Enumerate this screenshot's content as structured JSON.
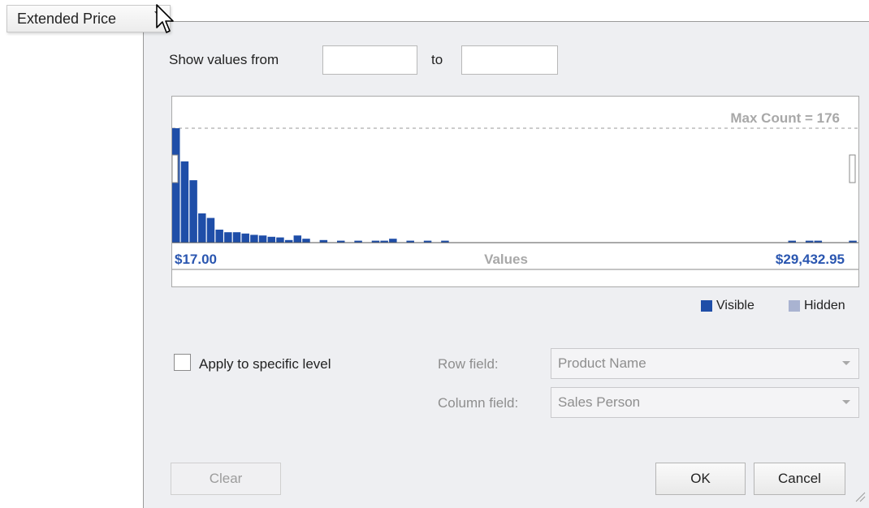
{
  "field_header": {
    "label": "Extended Price"
  },
  "range": {
    "from_label": "Show values from",
    "to_label": "to",
    "from_value": "",
    "to_value": ""
  },
  "chart_data": {
    "type": "bar",
    "annotation": "Max Count = 176",
    "max_count": 176,
    "x_min_label": "$17.00",
    "x_axis_label": "Values",
    "x_max_label": "$29,432.95",
    "values": [
      176,
      125,
      96,
      45,
      38,
      20,
      16,
      16,
      14,
      12,
      11,
      9,
      8,
      4,
      11,
      6,
      0,
      4,
      0,
      3,
      0,
      3,
      0,
      3,
      3,
      6,
      0,
      3,
      0,
      3,
      0,
      3,
      0,
      0,
      0,
      0,
      0,
      0,
      0,
      0,
      0,
      0,
      0,
      0,
      0,
      0,
      0,
      0,
      0,
      0,
      0,
      0,
      0,
      0,
      0,
      0,
      0,
      0,
      0,
      0,
      0,
      0,
      0,
      0,
      0,
      0,
      0,
      0,
      0,
      0,
      0,
      3,
      0,
      3,
      3,
      0,
      0,
      0,
      3
    ],
    "colors": {
      "visible": "#1f4ea8",
      "hidden": "#a9b3d1"
    }
  },
  "legend": {
    "visible_label": "Visible",
    "hidden_label": "Hidden"
  },
  "specific_level": {
    "checkbox_label": "Apply to specific level",
    "checked": false,
    "row_field_label": "Row field:",
    "row_field_value": "Product Name",
    "column_field_label": "Column field:",
    "column_field_value": "Sales Person"
  },
  "buttons": {
    "clear": "Clear",
    "ok": "OK",
    "cancel": "Cancel"
  }
}
